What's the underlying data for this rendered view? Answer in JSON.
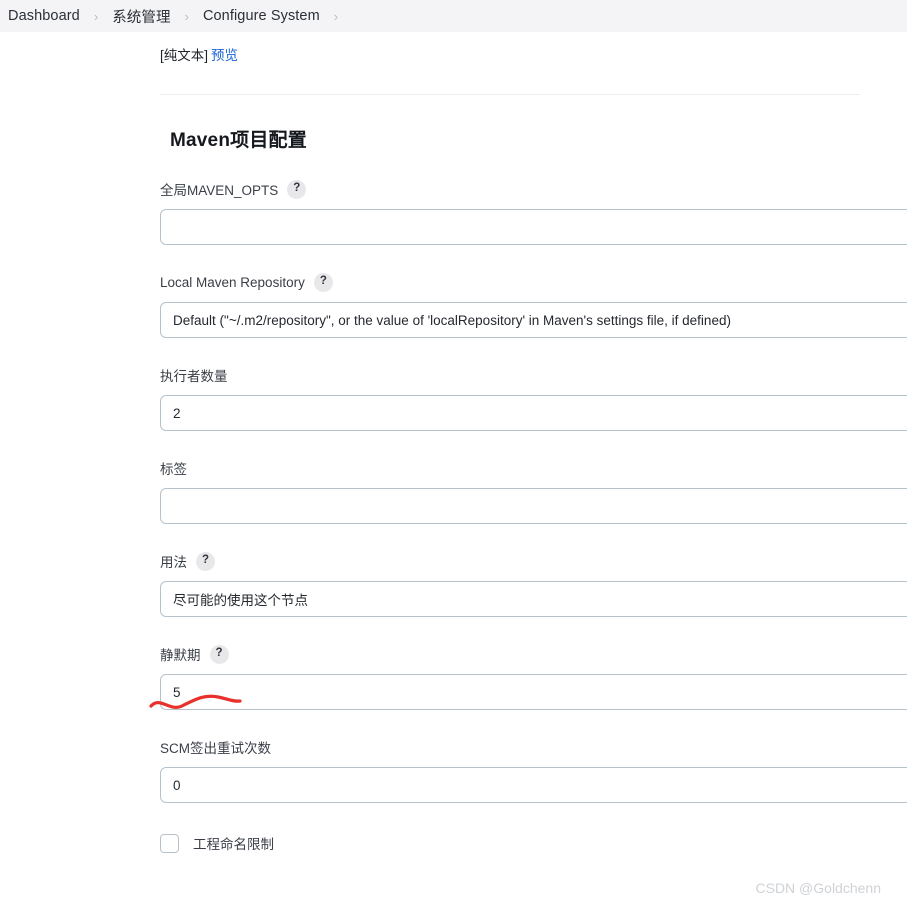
{
  "breadcrumb": {
    "separator": "›",
    "items": [
      {
        "label": "Dashboard"
      },
      {
        "label": "系统管理"
      },
      {
        "label": "Configure System"
      }
    ]
  },
  "top": {
    "plaintext_label": "[纯文本]",
    "preview_link": "预览"
  },
  "section": {
    "title": "Maven项目配置"
  },
  "fields": [
    {
      "label": "全局MAVEN_OPTS",
      "help": "?",
      "value": "",
      "placeholder": ""
    },
    {
      "label": "Local Maven Repository",
      "help": "?",
      "value": "Default (\"~/.m2/repository\", or the value of 'localRepository' in Maven's settings file, if defined)",
      "placeholder": ""
    },
    {
      "label": "执行者数量",
      "help": "",
      "value": "2",
      "placeholder": ""
    },
    {
      "label": "标签",
      "help": "",
      "value": "",
      "placeholder": ""
    },
    {
      "label": "用法",
      "help": "?",
      "value": "尽可能的使用这个节点",
      "placeholder": ""
    },
    {
      "label": "静默期",
      "help": "?",
      "value": "5",
      "placeholder": ""
    },
    {
      "label": "SCM签出重试次数",
      "help": "",
      "value": "0",
      "placeholder": ""
    }
  ],
  "checkbox": {
    "label": "工程命名限制",
    "checked": false
  },
  "annotation": {
    "color": "#e8312a",
    "shape": "wavy-underline",
    "target": "静默期"
  },
  "watermark": {
    "text": "CSDN @Goldchenn"
  },
  "colors": {
    "header_bg": "#f4f4f6",
    "link": "#1a62d6",
    "input_border": "#b7c3ca",
    "annotation_red": "#e8312a",
    "watermark": "#cfd2d6"
  }
}
